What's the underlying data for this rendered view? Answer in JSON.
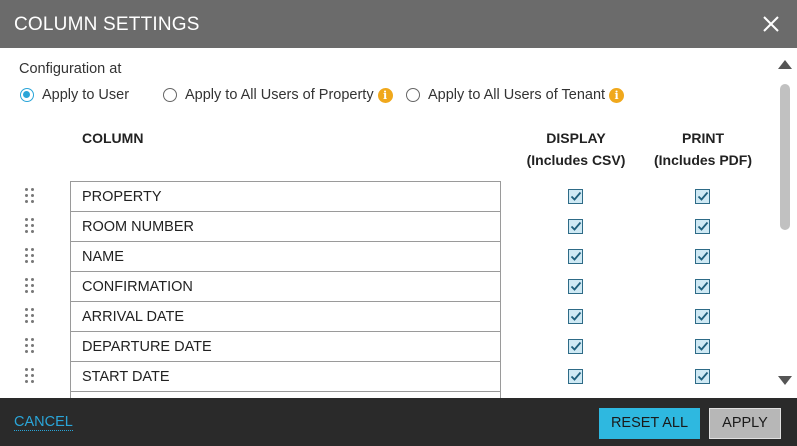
{
  "dialog": {
    "title": "COLUMN SETTINGS",
    "close_icon": "close-icon"
  },
  "config": {
    "label": "Configuration at",
    "options": [
      {
        "label": "Apply to User",
        "selected": true,
        "info": false
      },
      {
        "label": "Apply to All Users of Property",
        "selected": false,
        "info": true
      },
      {
        "label": "Apply to All Users of Tenant",
        "selected": false,
        "info": true
      }
    ],
    "info_glyph": "i"
  },
  "table": {
    "col_column": "COLUMN",
    "col_display_line1": "DISPLAY",
    "col_display_line2": "(Includes CSV)",
    "col_print_line1": "PRINT",
    "col_print_line2": "(Includes PDF)",
    "rows": [
      {
        "name": "PROPERTY",
        "display": true,
        "print": true
      },
      {
        "name": "ROOM NUMBER",
        "display": true,
        "print": true
      },
      {
        "name": "NAME",
        "display": true,
        "print": true
      },
      {
        "name": "CONFIRMATION",
        "display": true,
        "print": true
      },
      {
        "name": "ARRIVAL DATE",
        "display": true,
        "print": true
      },
      {
        "name": "DEPARTURE DATE",
        "display": true,
        "print": true
      },
      {
        "name": "START DATE",
        "display": true,
        "print": true
      },
      {
        "name": "",
        "display": true,
        "print": true
      }
    ]
  },
  "footer": {
    "cancel_label": "CANCEL",
    "reset_label": "RESET ALL",
    "apply_label": "APPLY"
  },
  "colors": {
    "header_bg": "#6b6b6b",
    "footer_bg": "#2a2a2a",
    "accent": "#2aa5d8",
    "reset_bg": "#2eb8e0",
    "info": "#f0a81c"
  }
}
